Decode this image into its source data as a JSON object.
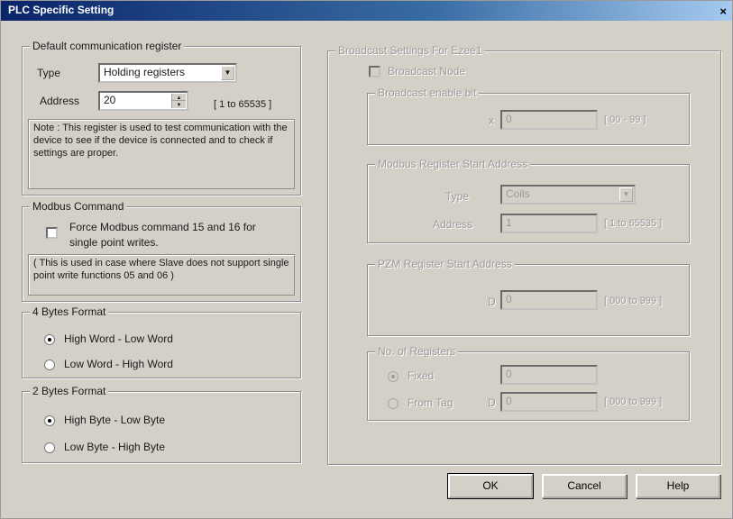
{
  "window": {
    "title": "PLC Specific Setting",
    "close": "×"
  },
  "default_comm": {
    "legend": "Default communication register",
    "type_label": "Type",
    "type_value": "Holding registers",
    "address_label": "Address",
    "address_value": "20",
    "range": "[ 1 to 65535 ]",
    "note": "Note : This register is used to test communication with the device to see if the device is connected and to check if settings are proper."
  },
  "modbus_command": {
    "legend": "Modbus Command",
    "checkbox_label": "Force Modbus command 15 and 16 for single point writes.",
    "checked": false,
    "note": "( This is used in case where Slave does not support single point write functions 05 and 06 )"
  },
  "four_bytes": {
    "legend": "4 Bytes Format",
    "options": [
      "High Word - Low Word",
      "Low Word - High Word"
    ],
    "selected": 0
  },
  "two_bytes": {
    "legend": "2 Bytes Format",
    "options": [
      "High Byte - Low Byte",
      "Low Byte - High Byte"
    ],
    "selected": 0
  },
  "broadcast": {
    "legend": "Broadcast Settings For Ezee1",
    "node_label": "Broadcast Node",
    "enable_bit": {
      "legend": "Broadcast enable bit",
      "prefix": "x",
      "value": "0",
      "range": "[ 00 - 99 ]"
    },
    "modbus_start": {
      "legend": "Modbus Register Start Address",
      "type_label": "Type",
      "type_value": "Coils",
      "address_label": "Address",
      "address_value": "1",
      "range": "[ 1 to 65535 ]"
    },
    "pzm_start": {
      "legend": "PZM Register Start Address",
      "prefix": "D",
      "value": "0",
      "range": "[ 000 to 999 ]"
    },
    "num_registers": {
      "legend": "No. of Registers",
      "fixed_label": "Fixed",
      "fixed_value": "0",
      "from_tag_label": "From Tag",
      "prefix": "D",
      "tag_value": "0",
      "range": "[ 000 to 999 ]",
      "selected": "fixed"
    }
  },
  "buttons": {
    "ok": "OK",
    "cancel": "Cancel",
    "help": "Help"
  },
  "icons": {
    "dropdown": "chevron-down-icon",
    "spin": "spin-arrows-icon"
  },
  "colors": {
    "titlebar_start": "#0a246a",
    "face": "#d4d0c8",
    "disabled_text": "#9a9a9a"
  }
}
